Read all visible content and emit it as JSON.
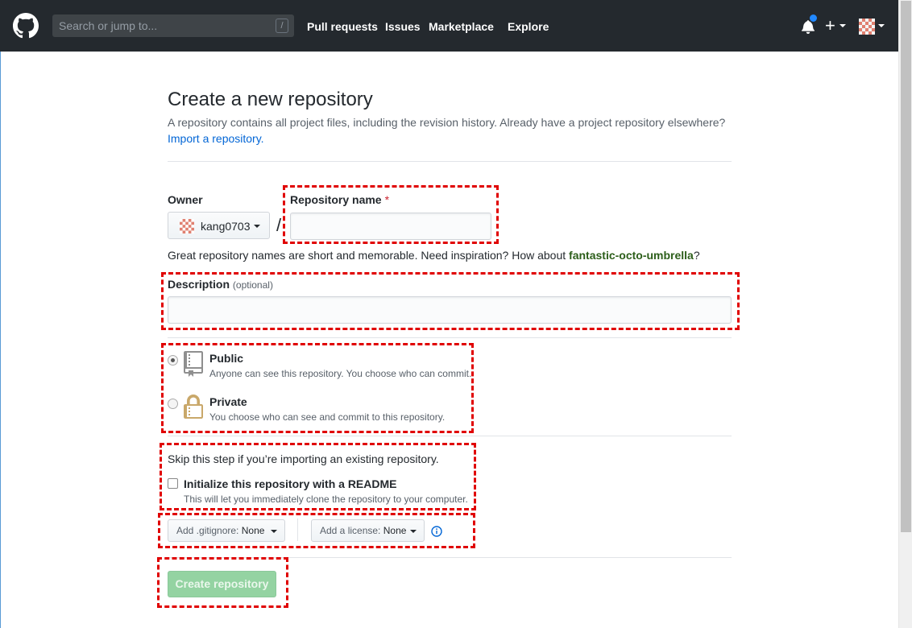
{
  "header": {
    "search_placeholder": "Search or jump to...",
    "search_shortcut": "/",
    "nav": [
      "Pull requests",
      "Issues",
      "Marketplace",
      "Explore"
    ],
    "plus_label": "+"
  },
  "page": {
    "title": "Create a new repository",
    "description": "A repository contains all project files, including the revision history. Already have a project repository elsewhere?",
    "import_link": "Import a repository."
  },
  "form": {
    "owner_label": "Owner",
    "owner_value": "kang0703",
    "separator": "/",
    "repo_name_label": "Repository name",
    "required_mark": "*",
    "name_hint_prefix": "Great repository names are short and memorable. Need inspiration? How about",
    "name_suggestion": "fantastic-octo-umbrella",
    "name_hint_suffix": "?",
    "description_label": "Description",
    "description_optional": "(optional)",
    "visibility": [
      {
        "title": "Public",
        "desc": "Anyone can see this repository. You choose who can commit.",
        "checked": true
      },
      {
        "title": "Private",
        "desc": "You choose who can see and commit to this repository.",
        "checked": false
      }
    ],
    "skip_note": "Skip this step if you’re importing an existing repository.",
    "readme_label": "Initialize this repository with a README",
    "readme_desc": "This will let you immediately clone the repository to your computer.",
    "gitignore_prefix": "Add .gitignore:",
    "gitignore_value": "None",
    "license_prefix": "Add a license:",
    "license_value": "None",
    "submit_label": "Create repository"
  },
  "colors": {
    "header_bg": "#24292e",
    "annotation": "#e00000",
    "submit_disabled": "#94d3a2",
    "link": "#0366d6"
  }
}
